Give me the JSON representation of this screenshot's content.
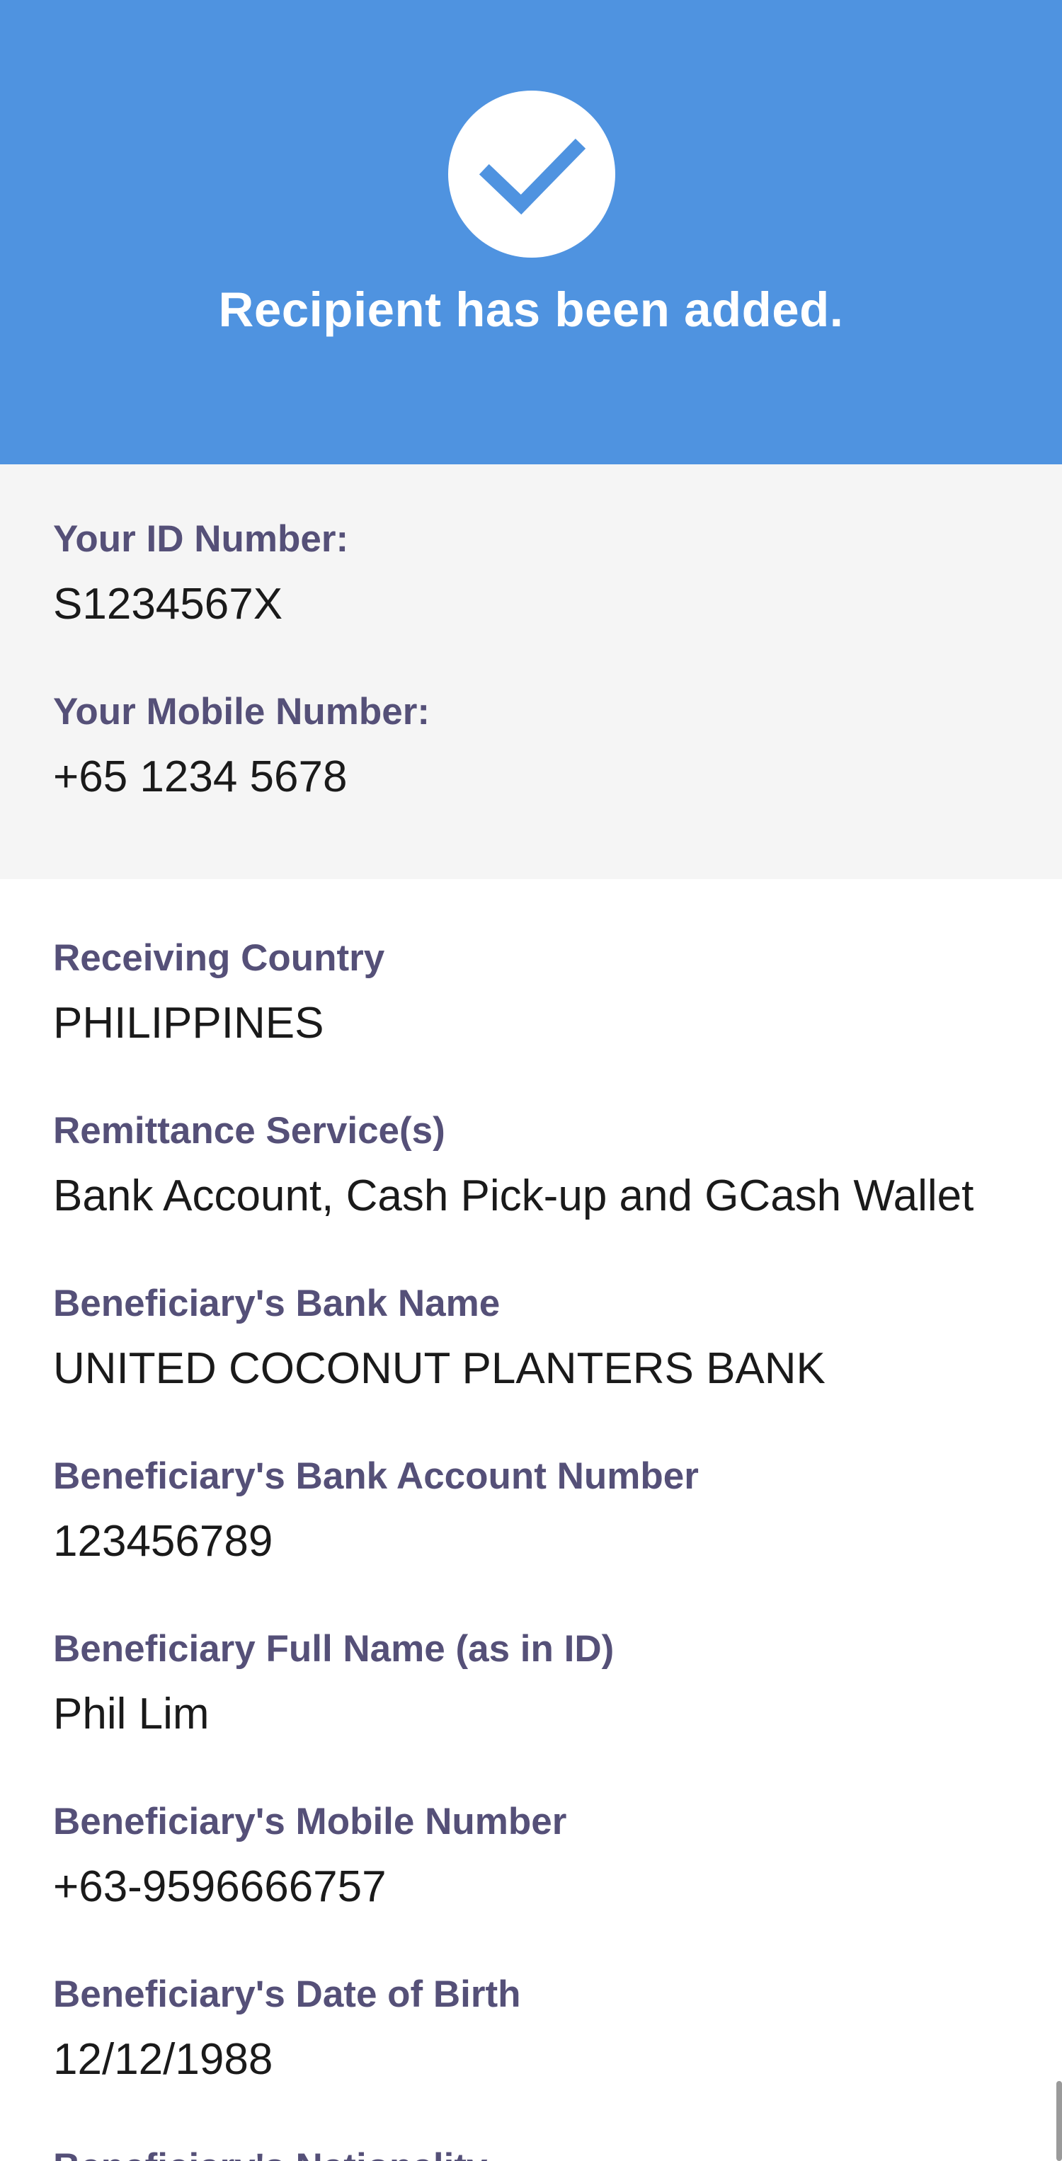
{
  "header": {
    "title": "Recipient has been added.",
    "icon": "check-icon",
    "background_color": "#4F93E0"
  },
  "user_info": {
    "id_label": "Your ID Number:",
    "id_value": "S1234567X",
    "mobile_label": "Your Mobile Number:",
    "mobile_value": "+65 1234 5678"
  },
  "details": [
    {
      "label": "Receiving Country",
      "value": "PHILIPPINES"
    },
    {
      "label": "Remittance Service(s)",
      "value": "Bank Account, Cash Pick-up and GCash Wallet"
    },
    {
      "label": "Beneficiary's Bank Name",
      "value": "UNITED COCONUT PLANTERS BANK"
    },
    {
      "label": "Beneficiary's Bank Account Number",
      "value": "123456789"
    },
    {
      "label": "Beneficiary Full Name (as in ID)",
      "value": "Phil Lim"
    },
    {
      "label": "Beneficiary's Mobile Number",
      "value": "+63-9596666757"
    },
    {
      "label": "Beneficiary's Date of Birth",
      "value": "12/12/1988"
    },
    {
      "label": "Beneficiary's Nationality",
      "value": ""
    }
  ]
}
